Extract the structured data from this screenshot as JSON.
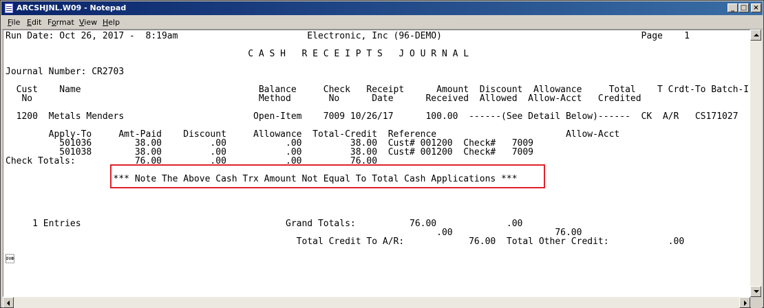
{
  "window": {
    "title": "ARCSHJNL.W09 - Notepad",
    "min_label": "_",
    "max_label": "□",
    "close_label": "×"
  },
  "menu": [
    {
      "label": "File",
      "mnemonic": "F",
      "rest": "ile"
    },
    {
      "label": "Edit",
      "mnemonic": "E",
      "rest": "dit"
    },
    {
      "label": "Format",
      "mnemonic": "o",
      "rest": "rmat",
      "prefix": "F"
    },
    {
      "label": "View",
      "mnemonic": "V",
      "rest": "iew"
    },
    {
      "label": "Help",
      "mnemonic": "H",
      "rest": "elp"
    }
  ],
  "document": {
    "lines": [
      "Run Date: Oct 26, 2017 -  8:19am                        Electronic, Inc (96-DEMO)                                     Page    1",
      "",
      "                                             C A S H   R E C E I P T S   J O U R N A L",
      "",
      "Journal Number: CR2703",
      "",
      "  Cust    Name                                 Balance     Check   Receipt      Amount  Discount  Allowance     Total    T Crdt-To Batch-ID",
      "   No                                          Method       No      Date      Received  Allowed  Allow-Acct   Credited",
      "",
      "  1200  Metals Menders                        Open-Item    7009 10/26/17      100.00  ------(See Detail Below)------  CK  A/R   CS171027",
      "",
      "        Apply-To     Amt-Paid    Discount     Allowance  Total-Credit  Reference                        Allow-Acct",
      "          501036        38.00         .00           .00         38.00  Cust# 001200  Check#   7009",
      "          501038        38.00         .00           .00         38.00  Cust# 001200  Check#   7009",
      "Check Totals:           76.00         .00           .00         76.00",
      "",
      "                    *** Note The Above Cash Trx Amount Not Equal To Total Cash Applications ***",
      "",
      "",
      "",
      "",
      "     1 Entries                                      Grand Totals:          76.00             .00",
      "                                                                                .00                   76.00",
      "                                                      Total Credit To A/R:            76.00  Total Other Credit:           .00",
      "",
      "\u001a"
    ]
  }
}
